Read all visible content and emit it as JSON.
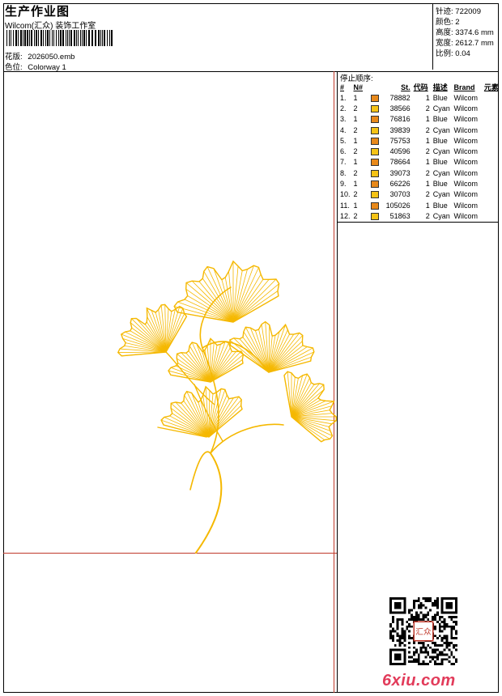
{
  "header": {
    "title": "生产作业图",
    "company": "Wilcom(汇众) 装饰工作室",
    "design_label": "花版:",
    "design_value": "2026050.emb",
    "colorway_label": "色位:",
    "colorway_value": "Colorway 1"
  },
  "meta": {
    "stitches_label": "针迹:",
    "stitches_value": "722009",
    "colors_label": "颜色:",
    "colors_value": "2",
    "height_label": "高度:",
    "height_value": "3374.6 mm",
    "width_label": "宽度:",
    "width_value": "2612.7 mm",
    "scale_label": "比例:",
    "scale_value": "0.04"
  },
  "sequence": {
    "title": "停止顺序:",
    "headers": [
      "#",
      "N#",
      "",
      "St.",
      "代码",
      "描述",
      "Brand",
      "元素"
    ],
    "rows": [
      {
        "idx": "1.",
        "n": "1",
        "color": "#e8891a",
        "st": "78882",
        "code": "1",
        "desc": "Blue",
        "brand": "Wilcom"
      },
      {
        "idx": "2.",
        "n": "2",
        "color": "#f5c316",
        "st": "38566",
        "code": "2",
        "desc": "Cyan",
        "brand": "Wilcom"
      },
      {
        "idx": "3.",
        "n": "1",
        "color": "#e8891a",
        "st": "76816",
        "code": "1",
        "desc": "Blue",
        "brand": "Wilcom"
      },
      {
        "idx": "4.",
        "n": "2",
        "color": "#f5c316",
        "st": "39839",
        "code": "2",
        "desc": "Cyan",
        "brand": "Wilcom"
      },
      {
        "idx": "5.",
        "n": "1",
        "color": "#e8891a",
        "st": "75753",
        "code": "1",
        "desc": "Blue",
        "brand": "Wilcom"
      },
      {
        "idx": "6.",
        "n": "2",
        "color": "#f5c316",
        "st": "40596",
        "code": "2",
        "desc": "Cyan",
        "brand": "Wilcom"
      },
      {
        "idx": "7.",
        "n": "1",
        "color": "#e8891a",
        "st": "78664",
        "code": "1",
        "desc": "Blue",
        "brand": "Wilcom"
      },
      {
        "idx": "8.",
        "n": "2",
        "color": "#f5c316",
        "st": "39073",
        "code": "2",
        "desc": "Cyan",
        "brand": "Wilcom"
      },
      {
        "idx": "9.",
        "n": "1",
        "color": "#e8891a",
        "st": "66226",
        "code": "1",
        "desc": "Blue",
        "brand": "Wilcom"
      },
      {
        "idx": "10.",
        "n": "2",
        "color": "#f5c316",
        "st": "30703",
        "code": "2",
        "desc": "Cyan",
        "brand": "Wilcom"
      },
      {
        "idx": "11.",
        "n": "1",
        "color": "#e8891a",
        "st": "105026",
        "code": "1",
        "desc": "Blue",
        "brand": "Wilcom"
      },
      {
        "idx": "12.",
        "n": "2",
        "color": "#f5c316",
        "st": "51863",
        "code": "2",
        "desc": "Cyan",
        "brand": "Wilcom"
      }
    ]
  },
  "footer": {
    "logo_text": "6xiu.com",
    "seal_text": "汇众"
  },
  "colors": {
    "thread": "#f5b800",
    "redline": "#c0392b"
  }
}
